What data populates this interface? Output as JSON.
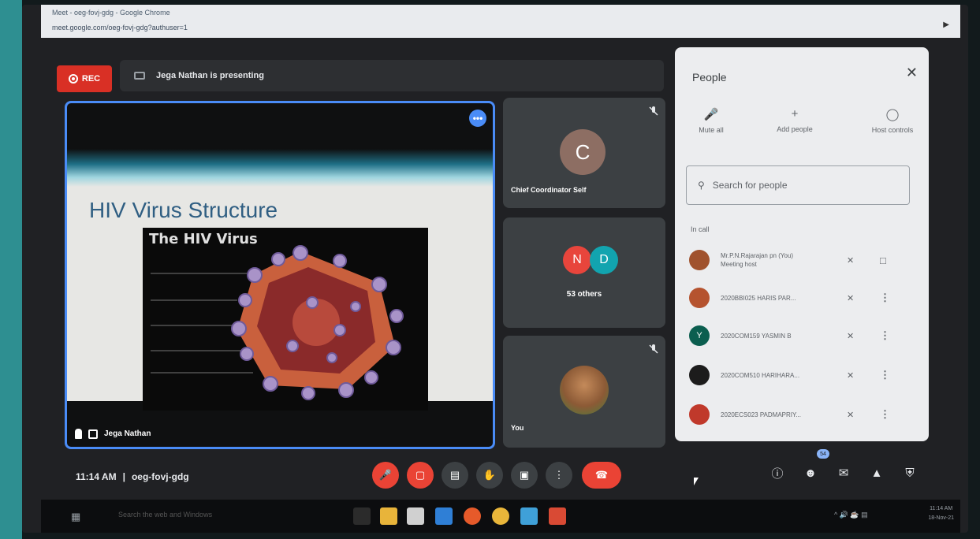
{
  "browser": {
    "tab_title": "Meet - oeg-fovj-gdg - Google Chrome",
    "url": "meet.google.com/oeg-fovj-gdg?authuser=1",
    "menu_icon": "kebab-icon"
  },
  "recording": {
    "label": "REC"
  },
  "presenting": {
    "text": "Jega Nathan is presenting"
  },
  "main_tile": {
    "slide_title": "HIV Virus Structure",
    "image_label": "The HIV Virus",
    "presenter_name": "Jega Nathan",
    "more_label": "•••"
  },
  "tiles": [
    {
      "avatar_letter": "C",
      "name": "Chief Coordinator Self",
      "avatar_color": "#8d6e63"
    },
    {
      "avatar_letters": [
        "N",
        "D"
      ],
      "label": "53 others"
    },
    {
      "name": "You"
    }
  ],
  "people_panel": {
    "title": "People",
    "close": "✕",
    "actions": [
      {
        "icon": "mic-off-icon",
        "label": "Mute all"
      },
      {
        "icon": "add-person-icon",
        "label": "Add people"
      },
      {
        "icon": "toggle-icon",
        "label": "Host controls"
      }
    ],
    "search_placeholder": "Search for people",
    "section_label": "In call",
    "participants": [
      {
        "name": "Mr.P.N.Rajarajan pn (You)",
        "role": "Meeting host",
        "avatar_color": "#a0522d",
        "letter": ""
      },
      {
        "name": "2020BBI025 HARIS PAR...",
        "role": "",
        "avatar_color": "#b5532f",
        "letter": ""
      },
      {
        "name": "2020COM159 YASMIN B",
        "role": "",
        "avatar_color": "#0b5e4f",
        "letter": "Y"
      },
      {
        "name": "2020COM510 HARIHARA...",
        "role": "",
        "avatar_color": "#1c1c1c",
        "letter": ""
      },
      {
        "name": "2020ECS023 PADMAPRIY...",
        "role": "",
        "avatar_color": "#c0392b",
        "letter": ""
      }
    ]
  },
  "bottom_bar": {
    "time": "11:14 AM",
    "separator": "|",
    "meeting_code": "oeg-fovj-gdg",
    "people_count": "54"
  },
  "taskbar": {
    "search_text": "Search the web and Windows",
    "time": "11:14 AM",
    "date": "18-Nov-21"
  },
  "colors": {
    "meet_bg": "#202124",
    "tile_bg": "#3c4043",
    "accent_blue": "#4a8cf7",
    "red": "#ea4335",
    "panel_bg": "#ecedef"
  }
}
